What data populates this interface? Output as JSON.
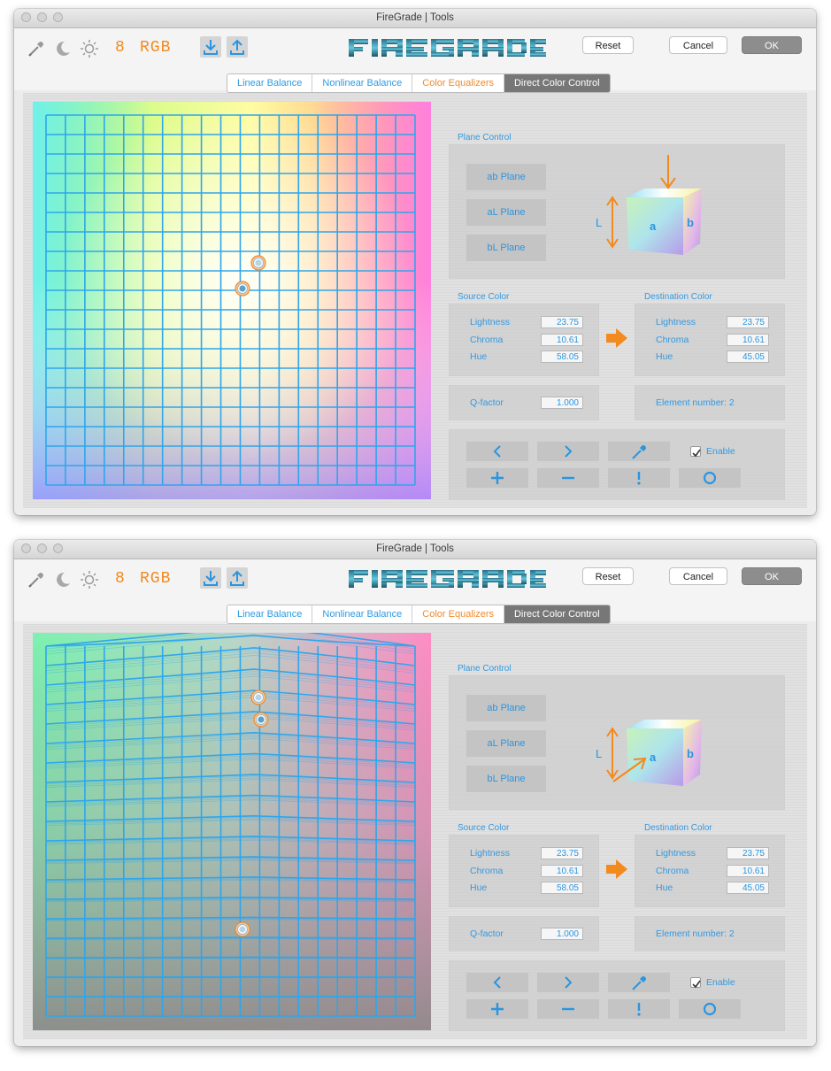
{
  "windows": [
    {
      "title": "FireGrade | Tools",
      "toolbar": {
        "bit_depth": "8",
        "color_model": "RGB",
        "reset_label": "Reset",
        "cancel_label": "Cancel",
        "ok_label": "OK",
        "icons": [
          "eyedropper-icon",
          "moon-icon",
          "sun-icon",
          "import-icon",
          "export-icon"
        ],
        "accent": "#f28a1e"
      },
      "tabs": [
        {
          "label": "Linear Balance",
          "state": "normal"
        },
        {
          "label": "Nonlinear Balance",
          "state": "normal"
        },
        {
          "label": "Color Equalizers",
          "state": "orange"
        },
        {
          "label": "Direct Color Control",
          "state": "active"
        }
      ],
      "plane_control": {
        "title": "Plane Control",
        "buttons": [
          "ab Plane",
          "aL Plane",
          "bL Plane"
        ],
        "cube_labels": {
          "L": "L",
          "a": "a",
          "b": "b"
        },
        "arrow": "top"
      },
      "source_color": {
        "title": "Source Color",
        "lightness_label": "Lightness",
        "lightness": "23.75",
        "chroma_label": "Chroma",
        "chroma": "10.61",
        "hue_label": "Hue",
        "hue": "58.05"
      },
      "destination_color": {
        "title": "Destination Color",
        "lightness_label": "Lightness",
        "lightness": "23.75",
        "chroma_label": "Chroma",
        "chroma": "10.61",
        "hue_label": "Hue",
        "hue": "45.05"
      },
      "q_factor": {
        "label": "Q-factor",
        "value": "1.000"
      },
      "element_number": "Element number: 2",
      "controls": {
        "enable_label": "Enable",
        "enabled": true
      },
      "plot": {
        "gradient": "color",
        "warped": false
      }
    },
    {
      "title": "FireGrade | Tools",
      "toolbar": {
        "bit_depth": "8",
        "color_model": "RGB",
        "reset_label": "Reset",
        "cancel_label": "Cancel",
        "ok_label": "OK",
        "icons": [
          "eyedropper-icon",
          "moon-icon",
          "sun-icon",
          "import-icon",
          "export-icon"
        ],
        "accent": "#f28a1e"
      },
      "tabs": [
        {
          "label": "Linear Balance",
          "state": "normal"
        },
        {
          "label": "Nonlinear Balance",
          "state": "normal"
        },
        {
          "label": "Color Equalizers",
          "state": "orange"
        },
        {
          "label": "Direct Color Control",
          "state": "active"
        }
      ],
      "plane_control": {
        "title": "Plane Control",
        "buttons": [
          "ab Plane",
          "aL Plane",
          "bL Plane"
        ],
        "cube_labels": {
          "L": "L",
          "a": "a",
          "b": "b"
        },
        "arrow": "front"
      },
      "source_color": {
        "title": "Source Color",
        "lightness_label": "Lightness",
        "lightness": "23.75",
        "chroma_label": "Chroma",
        "chroma": "10.61",
        "hue_label": "Hue",
        "hue": "58.05"
      },
      "destination_color": {
        "title": "Destination Color",
        "lightness_label": "Lightness",
        "lightness": "23.75",
        "chroma_label": "Chroma",
        "chroma": "10.61",
        "hue_label": "Hue",
        "hue": "45.05"
      },
      "q_factor": {
        "label": "Q-factor",
        "value": "1.000"
      },
      "element_number": "Element number: 2",
      "controls": {
        "enable_label": "Enable",
        "enabled": true
      },
      "plot": {
        "gradient": "muted",
        "warped": true
      }
    }
  ]
}
